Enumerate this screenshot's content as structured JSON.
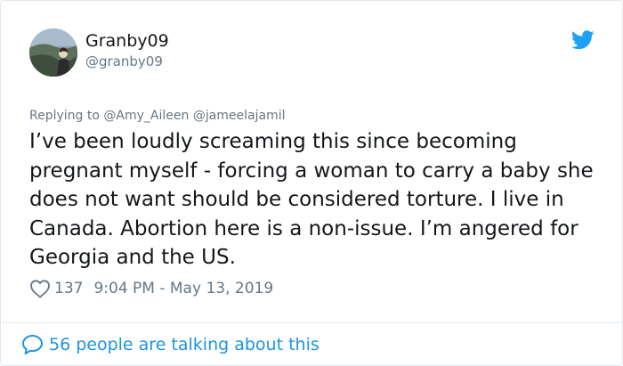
{
  "user": {
    "display_name": "Granby09",
    "handle": "@granby09",
    "avatar_icon": "profile-photo"
  },
  "brand": {
    "icon": "twitter-bird-icon",
    "color": "#1da1f2"
  },
  "reply": {
    "prefix": "Replying to",
    "mentions": [
      "@Amy_Aileen",
      "@jameelajamil"
    ]
  },
  "tweet": {
    "text": "I’ve been loudly screaming this since becoming pregnant myself - forcing a woman to carry a baby she does not want should be considered torture. I live in Canada. Abortion here is a non-issue. I’m angered for Georgia and the US.",
    "like_count": "137",
    "timestamp": "9:04 PM - May 13, 2019"
  },
  "footer": {
    "label": "56 people are talking about this",
    "icon": "speech-bubble-icon",
    "color": "#1b95e0"
  }
}
